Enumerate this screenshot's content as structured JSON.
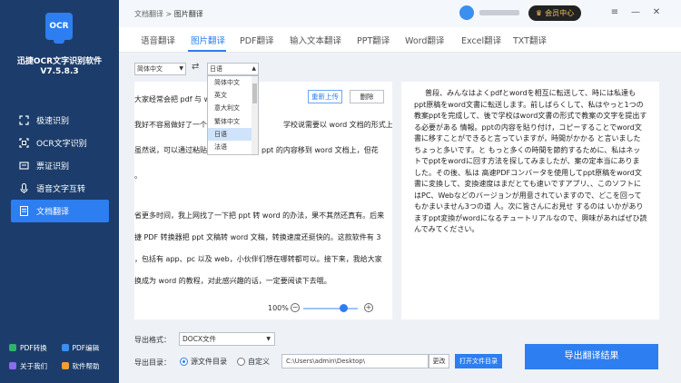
{
  "app": {
    "logo_text": "OCR",
    "name": "迅捷OCR文字识别软件",
    "version": "V7.5.8.3"
  },
  "sidebar": {
    "items": [
      {
        "label": "极速识别",
        "icon": "scan-icon"
      },
      {
        "label": "OCR文字识别",
        "icon": "ocr-icon"
      },
      {
        "label": "票证识别",
        "icon": "ticket-icon"
      },
      {
        "label": "语音文字互转",
        "icon": "microphone-icon"
      },
      {
        "label": "文档翻译",
        "icon": "document-translate-icon"
      }
    ],
    "bottom": [
      {
        "label": "PDF转换",
        "icon": "pdf-convert-icon",
        "color": "#2fb36a"
      },
      {
        "label": "PDF编辑",
        "icon": "pdf-edit-icon",
        "color": "#3a8ff0"
      },
      {
        "label": "关于我们",
        "icon": "about-icon",
        "color": "#8a6cf0"
      },
      {
        "label": "软件帮助",
        "icon": "help-icon",
        "color": "#f0a030"
      }
    ]
  },
  "topbar": {
    "breadcrumb_parent": "文档翻译",
    "breadcrumb_sep": " > ",
    "breadcrumb_current": "图片翻译",
    "vip_label": "会员中心",
    "win_menu": "≡",
    "win_min": "—",
    "win_close": "✕"
  },
  "tabs": [
    "语音翻译",
    "图片翻译",
    "PDF翻译",
    "输入文本翻译",
    "PPT翻译",
    "Word翻译",
    "Excel翻译",
    "TXT翻译"
  ],
  "active_tab": "图片翻译",
  "language": {
    "source": "简体中文",
    "target": "日语",
    "swap_icon": "⇄",
    "options": [
      "简体中文",
      "英文",
      "意大利文",
      "繁体中文",
      "日语",
      "法语"
    ],
    "highlighted": "日语"
  },
  "source_panel": {
    "lines": [
      "大家经常会把 pdf 与 w",
      "我好不容易做好了一个",
      "虽然说，可以通过粘贴",
      "。",
      "省更多时间，我上网找了一下把 ppt 转 word 的办法，果不其然还真有。后来",
      "捷 PDF 转换器把 ppt 文稿转 word 文稿，转换速度还挺快的。这款软件有 3",
      "，包括有 app、pc 以及 web，小伙伴们想在哪转都可以。接下来，我给大家",
      "换成为 word 的教程，对此感兴趣的话，一定要阅读下去哦。"
    ],
    "line2_tail": "学校说需要以 word 文档的形式上交教",
    "line3_tail": "ppt 的内容移到 word 文档上，但花",
    "reupload_label": "重新上传",
    "delete_label": "删除",
    "zoom": "100%"
  },
  "translated_text": "普段、みんなはよくpdfとwordを相互に転送して、時には私達もppt原稿をword文書に転送します。前しばらくして、私はやっと1つの教案pptを完成して、後で学校はword文書の形式で教案の文字を提出する必要がある 情報。pptの内容を貼り付け，コピーすることでword文書に移すことができると言っていますが，時間がかかる と言いました ちょっと多いです。と もっと多くの時間を節約するために、私はネットでpptをwordに回す方法を探してみましたが、案の定本当にありま した。その後、私は 高速PDFコンバータを使用してppt原稿をword文書に変換して、変換速度はまだとても速いですアプリ、、このソフトにはPC、Webなどのバージョンが用意されていますので、どこを回ってもかまいません3つの道 人。次に皆さんにお見せ するのは いかがありますppt変換がwordになるチュートリアルなので、興味があればぜひ読んでみてください。",
  "bottom": {
    "format_label": "导出格式：",
    "format_value": "DOCX文件",
    "dir_label": "导出目录：",
    "radio_source": "源文件目录",
    "radio_custom": "自定义",
    "path": "C:\\Users\\admin\\Desktop\\",
    "change_label": "更改",
    "open_label": "打开文件目录",
    "export_label": "导出翻译结果"
  }
}
